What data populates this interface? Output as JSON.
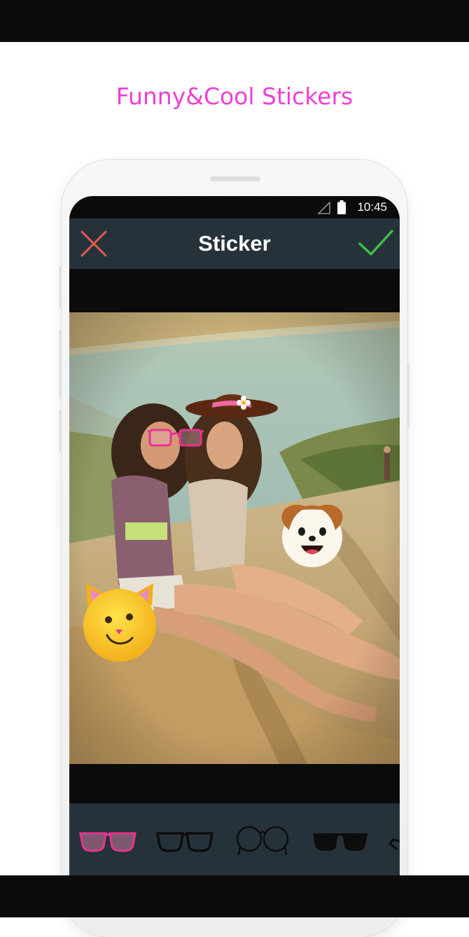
{
  "promo": {
    "headline": "Funny&Cool Stickers"
  },
  "status_bar": {
    "time": "10:45",
    "signal_icon": "signal-icon",
    "battery_icon": "battery-icon"
  },
  "app_bar": {
    "title": "Sticker",
    "cancel_icon": "close-icon",
    "confirm_icon": "check-icon"
  },
  "photo": {
    "stickers": [
      "hat-sticker",
      "pink-glasses-sticker",
      "dog-face-sticker",
      "cat-face-sticker"
    ]
  },
  "sticker_tray": {
    "items": [
      "pink-glasses",
      "black-frame-glasses",
      "round-glasses",
      "black-sunglasses",
      "partial-glasses"
    ]
  },
  "colors": {
    "headline": "#ee3fd4",
    "app_bar": "#26323a",
    "cancel": "#e35a4e",
    "confirm": "#3fbf4a",
    "pink": "#e8338f"
  }
}
